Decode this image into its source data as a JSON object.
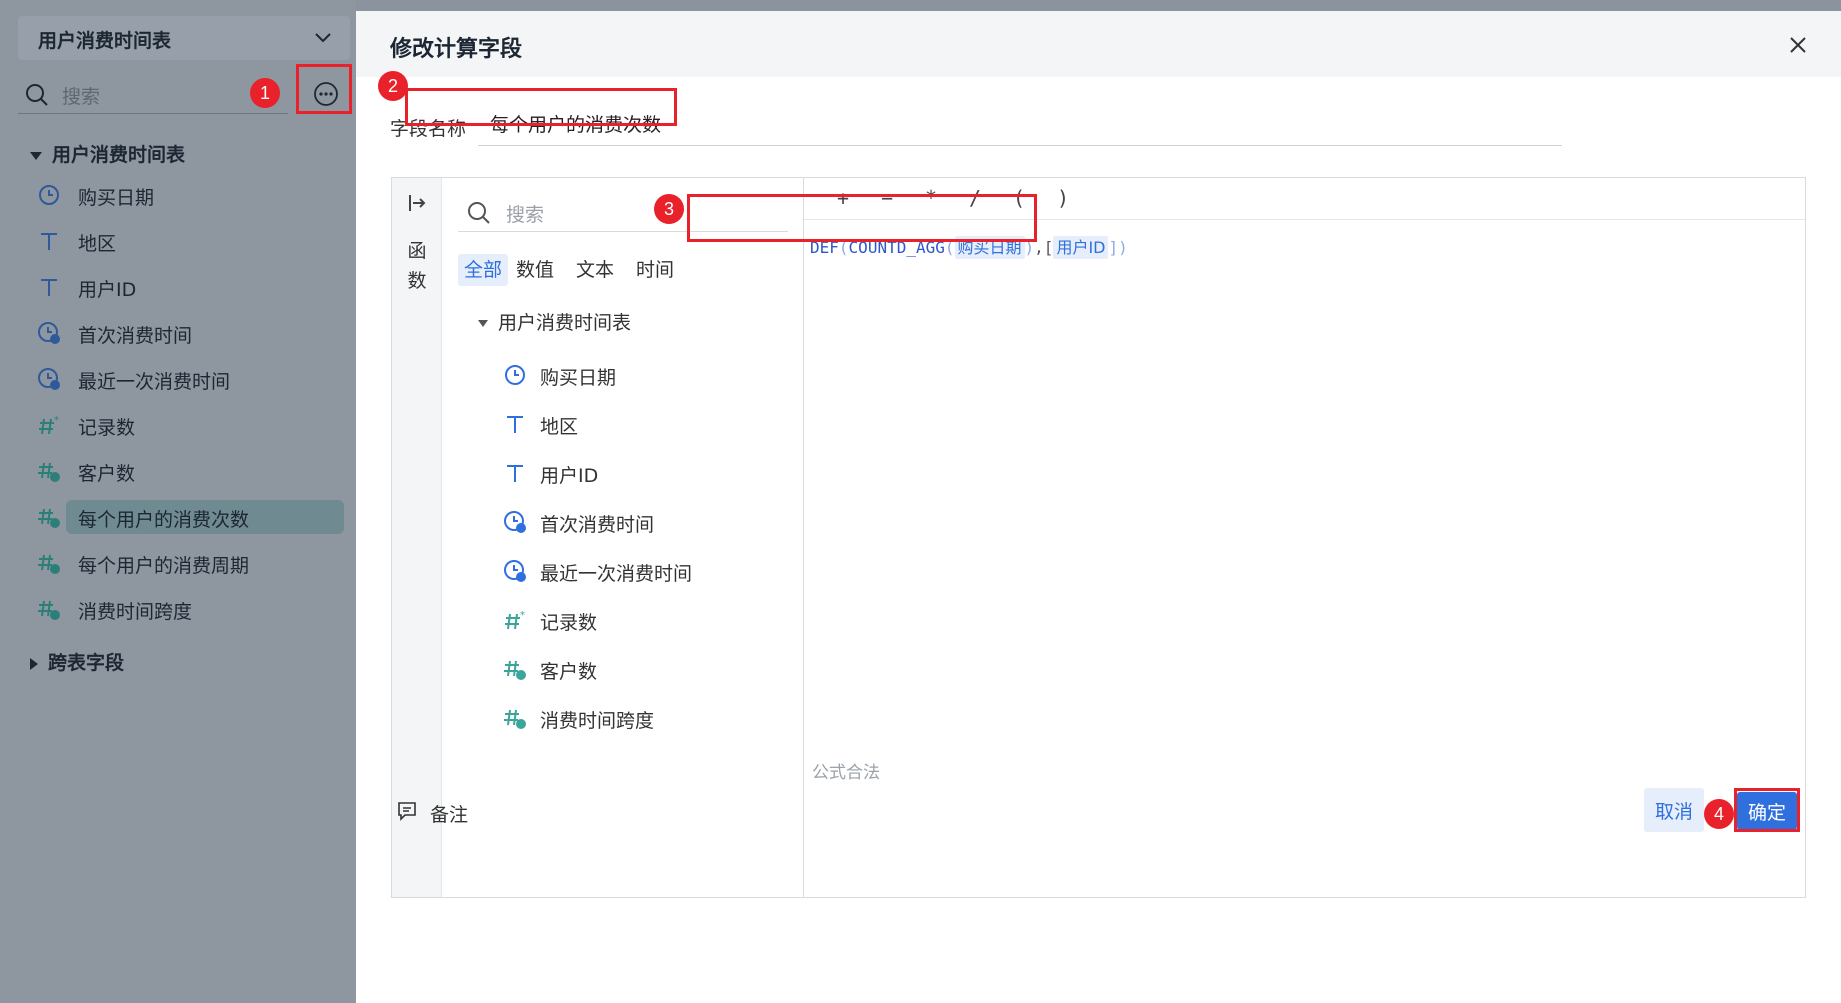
{
  "sidebar": {
    "dataset_title": "用户消费时间表",
    "search_placeholder": "搜索",
    "table_group": "用户消费时间表",
    "cross_table_group": "跨表字段",
    "fields": [
      {
        "label": "购买日期",
        "icon": "clock-icon"
      },
      {
        "label": "地区",
        "icon": "text-type-icon"
      },
      {
        "label": "用户ID",
        "icon": "text-type-icon"
      },
      {
        "label": "首次消费时间",
        "icon": "calc-date-icon"
      },
      {
        "label": "最近一次消费时间",
        "icon": "calc-date-icon"
      },
      {
        "label": "记录数",
        "icon": "record-count-icon"
      },
      {
        "label": "客户数",
        "icon": "calc-number-icon"
      },
      {
        "label": "每个用户的消费次数",
        "icon": "calc-number-icon",
        "selected": true
      },
      {
        "label": "每个用户的消费周期",
        "icon": "calc-number-icon"
      },
      {
        "label": "消费时间跨度",
        "icon": "calc-number-icon"
      }
    ]
  },
  "annotations": [
    "1",
    "2",
    "3",
    "4"
  ],
  "dialog": {
    "title": "修改计算字段",
    "field_name_label": "字段名称",
    "field_name_value": "每个用户的消费次数",
    "function_rail_label": [
      "函",
      "数"
    ],
    "search_placeholder": "搜索",
    "tabs": [
      "全部",
      "数值",
      "文本",
      "时间"
    ],
    "active_tab": "全部",
    "table_group": "用户消费时间表",
    "fields": [
      {
        "label": "购买日期",
        "icon": "clock-icon"
      },
      {
        "label": "地区",
        "icon": "text-type-icon"
      },
      {
        "label": "用户ID",
        "icon": "text-type-icon"
      },
      {
        "label": "首次消费时间",
        "icon": "calc-date-icon"
      },
      {
        "label": "最近一次消费时间",
        "icon": "calc-date-icon"
      },
      {
        "label": "记录数",
        "icon": "record-count-icon"
      },
      {
        "label": "客户数",
        "icon": "calc-number-icon"
      },
      {
        "label": "消费时间跨度",
        "icon": "calc-number-icon"
      }
    ],
    "operators": [
      "+",
      "−",
      "*",
      "/",
      "(",
      ")"
    ],
    "formula": {
      "fn_outer": "DEF",
      "open1": "(",
      "fn_inner": "COUNTD_AGG",
      "open2": "(",
      "field1": "购买日期",
      "close2": ")",
      "sep": ",[",
      "field2": "用户ID",
      "close1": "])"
    },
    "status": "公式合法",
    "note_label": "备注",
    "cancel_label": "取消",
    "confirm_label": "确定"
  },
  "colors": {
    "accent": "#2f6fde",
    "annotation_red": "#e8212b",
    "teal_icon": "#3aa59a"
  }
}
